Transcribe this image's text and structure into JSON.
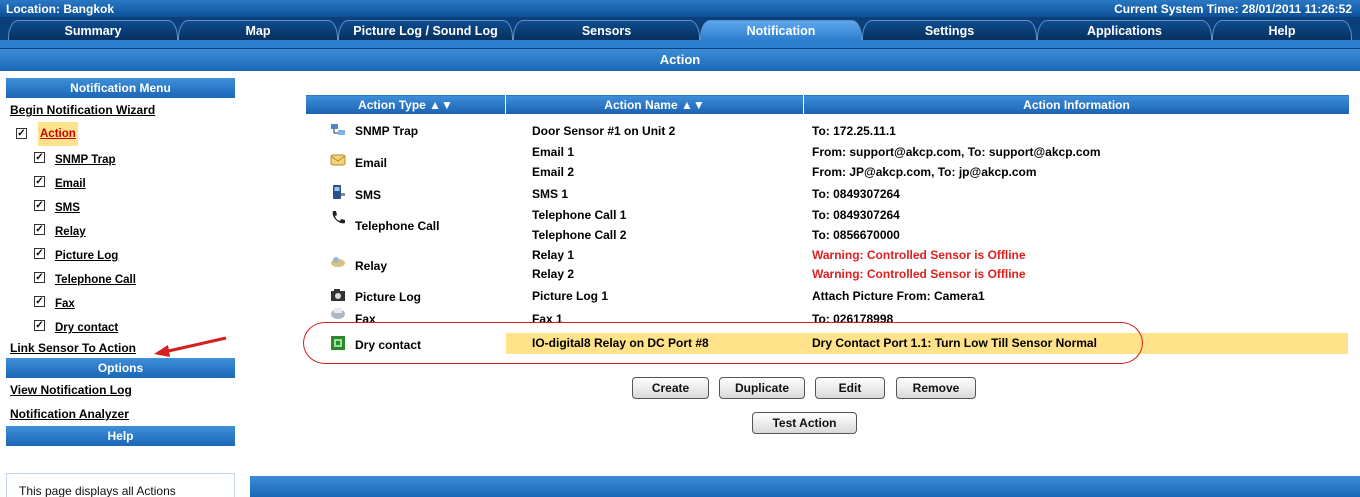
{
  "header": {
    "location": "Location: Bangkok",
    "system_time": "Current System Time: 28/01/2011 11:26:52"
  },
  "tabs": [
    {
      "label": "Summary"
    },
    {
      "label": "Map"
    },
    {
      "label": "Picture Log / Sound Log"
    },
    {
      "label": "Sensors"
    },
    {
      "label": "Notification",
      "active": true
    },
    {
      "label": "Settings"
    },
    {
      "label": "Applications"
    },
    {
      "label": "Help"
    }
  ],
  "page_title": "Action",
  "sidebar": {
    "menu_title": "Notification Menu",
    "wizard_link": "Begin Notification Wizard",
    "action_label": "Action",
    "items": [
      {
        "label": "SNMP Trap",
        "checked": true
      },
      {
        "label": "Email",
        "checked": true
      },
      {
        "label": "SMS",
        "checked": true
      },
      {
        "label": "Relay",
        "checked": true
      },
      {
        "label": "Picture Log",
        "checked": true
      },
      {
        "label": "Telephone Call",
        "checked": true
      },
      {
        "label": "Fax",
        "checked": true
      },
      {
        "label": "Dry contact",
        "checked": true
      }
    ],
    "link_sensor": "Link Sensor To Action",
    "options_title": "Options",
    "view_log": "View Notification Log",
    "analyzer": "Notification Analyzer",
    "help_title": "Help",
    "help_text": "This page displays all Actions"
  },
  "table": {
    "headers": [
      "Action Type ▲▼",
      "Action Name ▲▼",
      "Action Information"
    ],
    "types": [
      {
        "label": "SNMP Trap",
        "icon": "snmp-icon"
      },
      {
        "label": "Email",
        "icon": "email-icon"
      },
      {
        "label": "SMS",
        "icon": "sms-icon"
      },
      {
        "label": "Telephone Call",
        "icon": "telephone-icon"
      },
      {
        "label": "Relay",
        "icon": "relay-icon"
      },
      {
        "label": "Picture Log",
        "icon": "camera-icon"
      },
      {
        "label": "Fax",
        "icon": "fax-icon"
      },
      {
        "label": "Dry contact",
        "icon": "dry-contact-icon"
      }
    ],
    "rows": [
      {
        "name": "Door Sensor #1 on Unit 2",
        "info": "To: 172.25.11.1",
        "warn": false
      },
      {
        "name": "Email 1",
        "info": "From: support@akcp.com, To: support@akcp.com",
        "warn": false
      },
      {
        "name": "Email 2",
        "info": "From: JP@akcp.com, To: jp@akcp.com",
        "warn": false
      },
      {
        "name": "SMS 1",
        "info": "To: 0849307264",
        "warn": false
      },
      {
        "name": "Telephone Call 1",
        "info": "To: 0849307264",
        "warn": false
      },
      {
        "name": "Telephone Call 2",
        "info": "To: 0856670000",
        "warn": false
      },
      {
        "name": "Relay 1",
        "info": "Warning: Controlled Sensor is Offline",
        "warn": true
      },
      {
        "name": "Relay 2",
        "info": "Warning: Controlled Sensor is Offline",
        "warn": true
      },
      {
        "name": "Picture Log 1",
        "info": "Attach Picture From: Camera1",
        "warn": false
      },
      {
        "name": "Fax 1",
        "info": "To: 026178998",
        "warn": false
      },
      {
        "name": "IO-digital8 Relay on DC Port #8",
        "info": "Dry Contact Port 1.1: Turn Low Till Sensor Normal",
        "warn": false
      }
    ]
  },
  "buttons": {
    "create": "Create",
    "duplicate": "Duplicate",
    "edit": "Edit",
    "remove": "Remove",
    "test": "Test Action"
  },
  "colors": {
    "header_blue": "#1966b7",
    "highlight": "#ffe28a",
    "warning": "#e02020",
    "annotation_red": "#d62020"
  }
}
